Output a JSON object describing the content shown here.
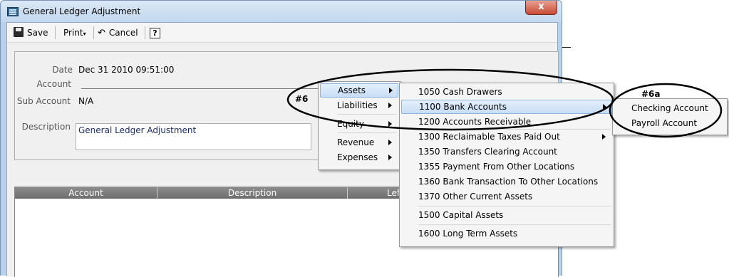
{
  "window": {
    "title": "General Ledger Adjustment",
    "close_glyph": "x"
  },
  "toolbar": {
    "save_label": "Save",
    "print_label": "Print",
    "cancel_label": "Cancel",
    "help_glyph": "?"
  },
  "form": {
    "date_label": "Date",
    "date_value": "Dec 31 2010 09:51:00",
    "account_label": "Account",
    "sub_account_label": "Sub Account",
    "sub_account_value": "N/A",
    "description_label": "Description",
    "description_value": "General Ledger Adjustment"
  },
  "grid": {
    "columns": [
      "Account",
      "Description",
      "Left"
    ]
  },
  "menu_level1": {
    "items": [
      "Assets",
      "Liabilities",
      "Equity",
      "Revenue",
      "Expenses"
    ],
    "highlighted": "Assets"
  },
  "menu_level2": {
    "items": [
      "1050 Cash Drawers",
      "1100 Bank Accounts",
      "1200 Accounts Receivable",
      "1300 Reclaimable Taxes Paid Out",
      "1350 Transfers Clearing Account",
      "1355 Payment From Other Locations",
      "1360 Bank Transaction To Other Locations",
      "1370 Other Current Assets",
      "1500 Capital Assets",
      "1600 Long Term Assets"
    ],
    "highlighted": "1100 Bank Accounts"
  },
  "menu_level3": {
    "items": [
      "Checking Account",
      "Payroll Account"
    ]
  },
  "annotations": {
    "tag_main": "#6",
    "tag_sub": "#6a"
  }
}
